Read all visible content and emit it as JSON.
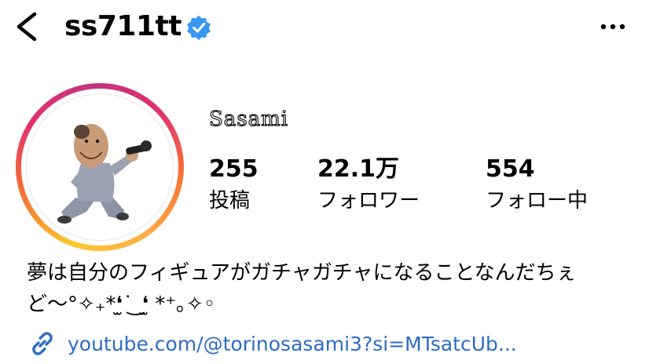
{
  "header": {
    "username": "ss711tt",
    "verified": true,
    "back_icon": "chevron-left-icon",
    "more_icon": "ellipsis-icon"
  },
  "profile": {
    "display_name": "Sasami",
    "stats": [
      {
        "value": "255",
        "label": "投稿"
      },
      {
        "value": "22.1万",
        "label": "フォロワー"
      },
      {
        "value": "554",
        "label": "フォロー中"
      }
    ],
    "bio_line1": "夢は自分のフィギュアがガチャガチャになることなんだちぇ",
    "bio_line2": "ど〜°✧₊*❛̫ ͘ ͜ ❛̫ *⁺｡✧◦",
    "link": "youtube.com/@torinosasami3?si=MTsatcUb..."
  },
  "colors": {
    "link": "#2d6cc5",
    "verified_badge": "#3897f0",
    "ring_gradient": [
      "#fdc830",
      "#f37335",
      "#e1306c",
      "#c13584"
    ]
  }
}
